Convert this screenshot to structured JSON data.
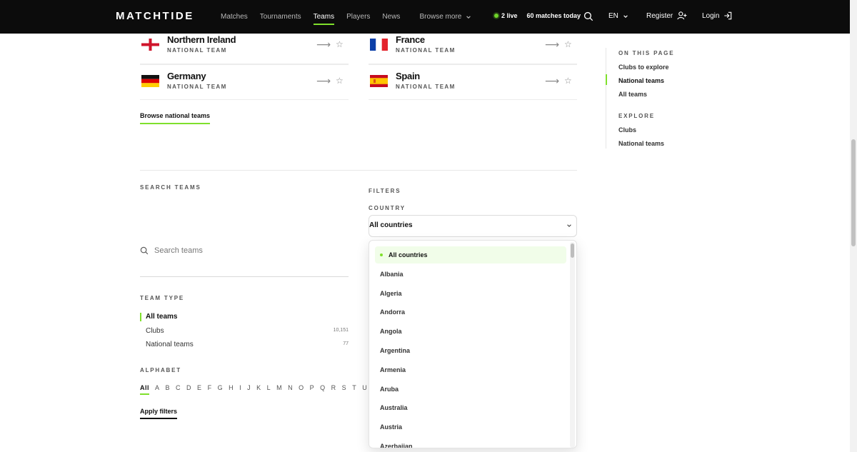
{
  "header": {
    "logo": "MATCHTIDE",
    "nav": [
      {
        "label": "Matches",
        "active": false
      },
      {
        "label": "Tournaments",
        "active": false
      },
      {
        "label": "Teams",
        "active": true
      },
      {
        "label": "Players",
        "active": false
      },
      {
        "label": "News",
        "active": false
      }
    ],
    "browse_more": "Browse more",
    "live_count": "2 live",
    "matches_today": "60 matches today",
    "language": "EN",
    "register": "Register",
    "login": "Login"
  },
  "featured_teams": [
    {
      "name": "Northern Ireland",
      "subtitle": "NATIONAL TEAM",
      "flag": "northern-ireland-flag"
    },
    {
      "name": "France",
      "subtitle": "NATIONAL TEAM",
      "flag": "france-flag"
    },
    {
      "name": "Germany",
      "subtitle": "NATIONAL TEAM",
      "flag": "germany-flag"
    },
    {
      "name": "Spain",
      "subtitle": "NATIONAL TEAM",
      "flag": "spain-flag"
    }
  ],
  "browse_national_teams": "Browse national teams",
  "search": {
    "heading": "SEARCH TEAMS",
    "placeholder": "Search teams",
    "value": ""
  },
  "team_type": {
    "heading": "TEAM TYPE",
    "items": [
      {
        "label": "All teams",
        "count": "",
        "active": true
      },
      {
        "label": "Clubs",
        "count": "10,151",
        "active": false
      },
      {
        "label": "National teams",
        "count": "77",
        "active": false
      }
    ]
  },
  "alphabet": {
    "heading": "ALPHABET",
    "letters": [
      "All",
      "A",
      "B",
      "C",
      "D",
      "E",
      "F",
      "G",
      "H",
      "I",
      "J",
      "K",
      "L",
      "M",
      "N",
      "O",
      "P",
      "Q",
      "R",
      "S",
      "T",
      "U"
    ],
    "active": "All"
  },
  "apply_filters": "Apply filters",
  "filters": {
    "heading": "FILTERS",
    "country_label": "COUNTRY",
    "country_value": "All countries",
    "options": [
      "All countries",
      "Albania",
      "Algeria",
      "Andorra",
      "Angola",
      "Argentina",
      "Armenia",
      "Aruba",
      "Australia",
      "Austria",
      "Azerbaijan"
    ],
    "selected": "All countries"
  },
  "on_this_page": {
    "heading": "ON THIS PAGE",
    "links": [
      {
        "label": "Clubs to explore",
        "active": false
      },
      {
        "label": "National teams",
        "active": true
      },
      {
        "label": "All teams",
        "active": false
      }
    ]
  },
  "explore": {
    "heading": "EXPLORE",
    "links": [
      "Clubs",
      "National teams"
    ]
  },
  "colors": {
    "accent": "#7fe02c",
    "header_bg": "#0c0c0c"
  }
}
